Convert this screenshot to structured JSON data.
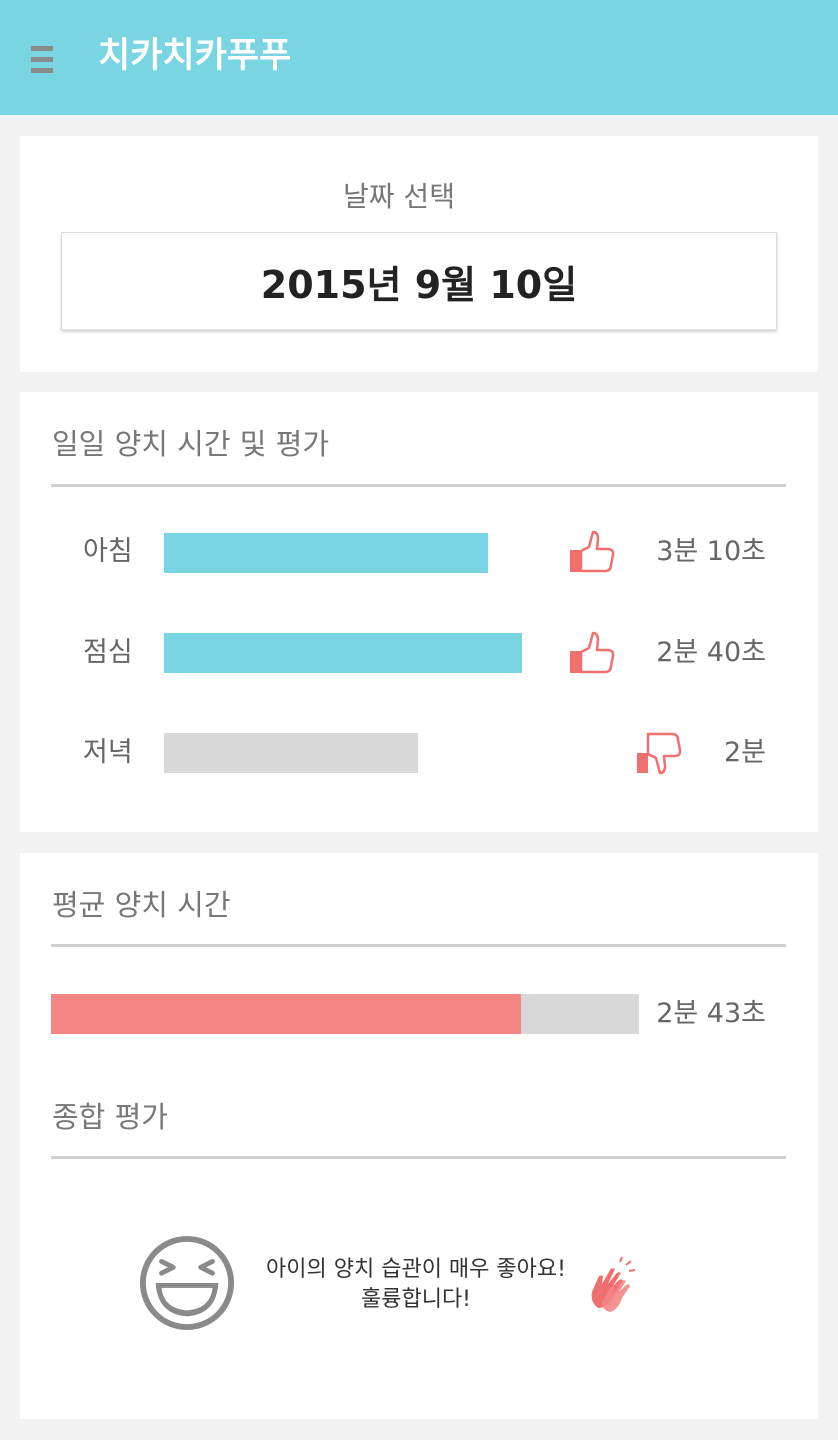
{
  "app": {
    "title": "치카치카푸푸",
    "accent_color": "#78d5e1",
    "menu_icon": "hamburger-menu-icon"
  },
  "date_section": {
    "label": "날짜 선택",
    "value": "2015년 9월 10일"
  },
  "daily_section": {
    "title": "일일 양치 시간 및 평가",
    "rows": [
      {
        "label": "아침",
        "time": "3분 10초",
        "rating": "thumbs-up-icon",
        "level": 0.56,
        "color": "#78d5e1"
      },
      {
        "label": "점심",
        "time": "2분 40초",
        "rating": "thumbs-up-icon",
        "level": 0.62,
        "color": "#78d5e1"
      },
      {
        "label": "저녁",
        "time": "2분",
        "rating": "thumbs-down-icon",
        "level": 0.44,
        "color": "#d8d8d8"
      }
    ]
  },
  "average_section": {
    "title": "평균 양치 시간",
    "time": "2분 43초",
    "level": 0.8,
    "fill_color": "#f48585"
  },
  "overall_section": {
    "title": "종합 평가",
    "message_line1": "아이의 양치 습관이 매우 좋아요!",
    "message_line2": "훌륭합니다!",
    "face_icon": "laughing-face-icon",
    "clap_icon": "clapping-hands-icon"
  }
}
